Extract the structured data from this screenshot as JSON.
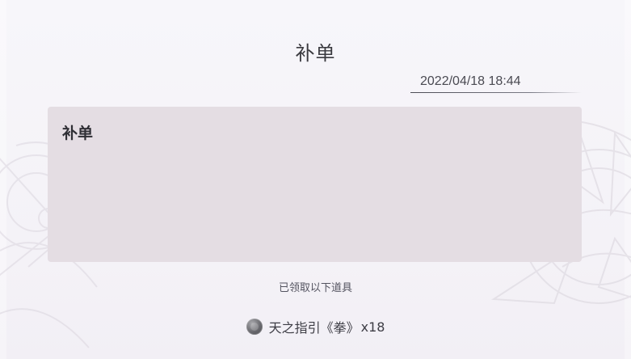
{
  "mail": {
    "title": "补单",
    "date": "2022/04/18 18:44",
    "content": "补单",
    "received_label": "已领取以下道具"
  },
  "reward": {
    "icon": "reward-icon",
    "name": "天之指引《拳》",
    "quantity": "x18"
  },
  "colors": {
    "background": "#f3f1f6",
    "content_box": "#e4dde3",
    "text_dark": "#3a3a3f",
    "text_mid": "#545460"
  }
}
